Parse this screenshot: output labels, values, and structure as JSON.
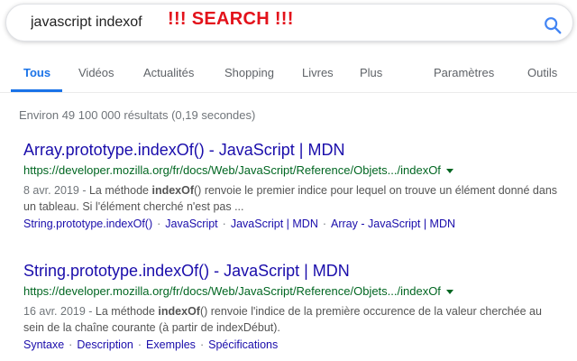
{
  "search": {
    "query": "javascript indexof",
    "annotation": "!!! SEARCH !!!"
  },
  "tabs": [
    {
      "label": "Tous",
      "active": true
    },
    {
      "label": "Vidéos"
    },
    {
      "label": "Actualités"
    },
    {
      "label": "Shopping"
    },
    {
      "label": "Livres"
    },
    {
      "label": "Plus"
    },
    {
      "label": "Paramètres"
    },
    {
      "label": "Outils"
    }
  ],
  "stats": "Environ 49 100 000 résultats (0,19 secondes)",
  "results": [
    {
      "title": "Array.prototype.indexOf() - JavaScript | MDN",
      "url": "https://developer.mozilla.org/fr/docs/Web/JavaScript/Reference/Objets.../indexOf",
      "date": "8 avr. 2019",
      "date_sep": " - ",
      "snippet": {
        "before": "La méthode ",
        "bold": "indexOf",
        "after": "() renvoie le premier indice pour lequel on trouve un élément donné dans un tableau. Si l'élément cherché n'est pas ..."
      },
      "links": [
        "String.prototype.indexOf()",
        "JavaScript",
        "JavaScript | MDN",
        "Array - JavaScript | MDN"
      ]
    },
    {
      "title": "String.prototype.indexOf() - JavaScript | MDN",
      "url": "https://developer.mozilla.org/fr/docs/Web/JavaScript/Reference/Objets.../indexOf",
      "date": "16 avr. 2019",
      "date_sep": " - ",
      "snippet": {
        "before": "La méthode ",
        "bold": "indexOf",
        "after": "() renvoie l'indice de la première occurence de la valeur cherchée au sein de la chaîne courante (à partir de indexDébut)."
      },
      "links": [
        "Syntaxe",
        "Description",
        "Exemples",
        "Spécifications"
      ]
    }
  ],
  "link_separator": "·",
  "colors": {
    "annotation": "#e3121b",
    "title_link": "#1a0dab",
    "url_green": "#006621",
    "accent_blue": "#1a73e8",
    "muted_text": "#70757a"
  },
  "icons": {
    "search": "search-icon",
    "url_dropdown": "caret-down-icon"
  }
}
